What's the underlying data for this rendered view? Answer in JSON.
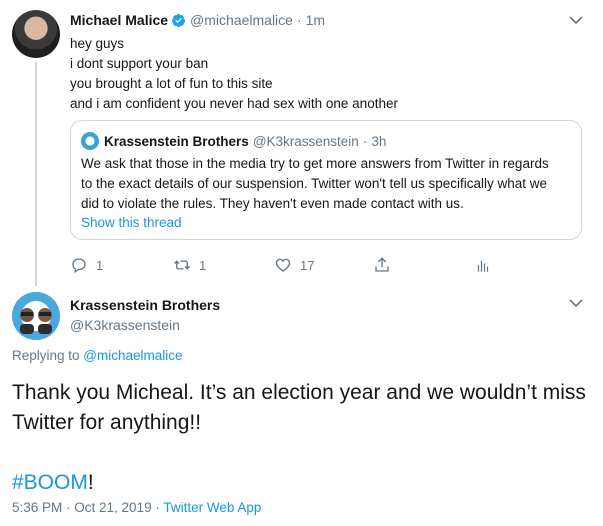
{
  "original_tweet": {
    "display_name": "Michael Malice",
    "handle": "@michaelmalice",
    "time_ago": "1m",
    "lines": [
      "hey guys",
      "i dont support your ban",
      "you brought a lot of fun to this site",
      "and i am confident you never had sex with one another"
    ],
    "quoted_tweet": {
      "display_name": "Krassenstein Brothers",
      "handle": "@K3krassenstein",
      "time_ago": "3h",
      "lines": [
        "We ask that those in the media try to get more answers from Twitter in regards",
        "to the exact details of our suspension. Twitter won't tell us specifically what we",
        "did to violate the rules.  They haven't even made contact with us."
      ],
      "show_thread": "Show this thread"
    },
    "actions": {
      "reply_count": "1",
      "retweet_count": "1",
      "like_count": "17"
    }
  },
  "reply_tweet": {
    "display_name": "Krassenstein Brothers",
    "handle": "@K3krassenstein",
    "replying_prefix": "Replying to ",
    "replying_to": "@michaelmalice",
    "lines": [
      "Thank you Micheal. It’s an election year and we wouldn’t miss",
      "Twitter for anything!!"
    ],
    "hashtag": "#BOOM",
    "hashtag_suffix": "!",
    "timestamp": "5:36 PM · Oct 21, 2019",
    "separator": " · ",
    "source_app": "Twitter Web App"
  },
  "colors": {
    "link_blue": "#1b95e0",
    "muted_gray": "#657786",
    "border": "#ccd6dd",
    "verified_blue": "#1da1f2"
  }
}
